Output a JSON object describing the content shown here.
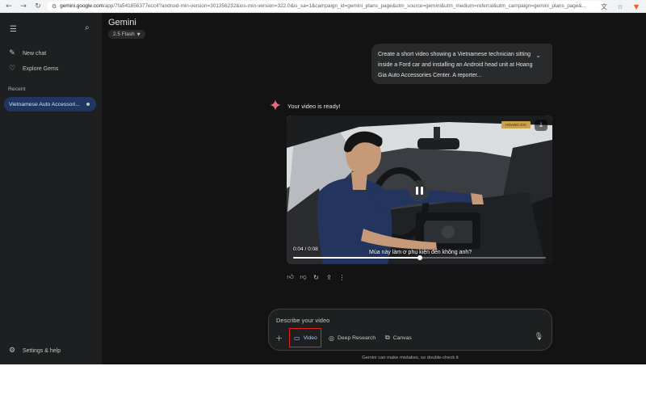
{
  "browser": {
    "url_domain": "gemini.google.com",
    "url_rest": "/app/7fa541856377ecc4?android-min-version=301356232&ios-min-version=322.0&is_sa=1&campaign_id=gemini_plans_page&utm_source=gemini&utm_medium=referral&utm_campaign=gemini_plans_page&...",
    "icons": [
      "back-icon",
      "forward-icon",
      "reload-icon",
      "site-info-icon",
      "translate-icon",
      "bookmark-star-icon",
      "brave-shield-icon"
    ]
  },
  "sidebar": {
    "items": [
      {
        "label": "New chat",
        "icon": "edit-icon"
      },
      {
        "label": "Explore Gems",
        "icon": "gem-icon"
      }
    ],
    "recent_label": "Recent",
    "recent_item": "Vietnamese Auto Accessori...",
    "settings_label": "Settings & help"
  },
  "header": {
    "title": "Gemini",
    "model": "2.5 Flash"
  },
  "user_message": {
    "text": "Create a short video showing a Vietnamese technician sitting inside a Ford car and installing an Android head unit at Hoang Gia Auto Accessories Center. A reporter..."
  },
  "reply": {
    "text": "Your video is ready!"
  },
  "video": {
    "time": "0:04 / 0:08",
    "progress": 0.5,
    "subtitle": "Mùa này làm ơ phụ kiện đến không anh?",
    "brand_tag": "HOANG GIA"
  },
  "composer": {
    "placeholder": "Describe your video",
    "tools": [
      {
        "label": "Video",
        "icon": "video-icon",
        "active": true
      },
      {
        "label": "Deep Research",
        "icon": "deep-research-icon",
        "active": false
      },
      {
        "label": "Canvas",
        "icon": "canvas-icon",
        "active": false
      }
    ]
  },
  "disclaimer": "Gemini can make mistakes, so double-check it",
  "colors": {
    "app_bg": "#131314",
    "sidebar_bg": "#1e1f20",
    "accent": "#a8c7fa",
    "highlight_box": "#e0261b"
  }
}
